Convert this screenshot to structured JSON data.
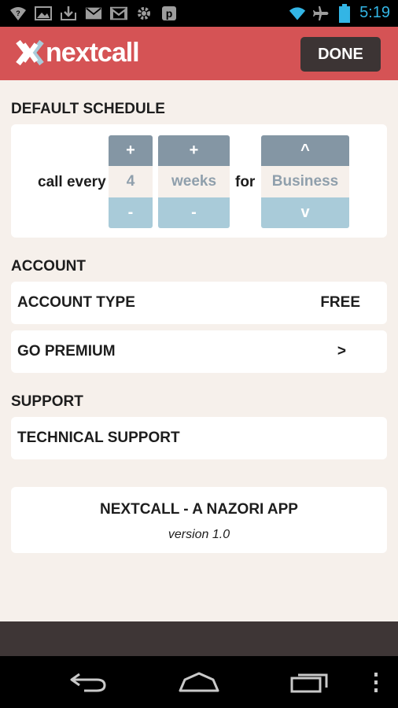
{
  "status_bar": {
    "time": "5:19",
    "notification_icons": [
      "wifi-question-icon",
      "image-icon",
      "download-icon",
      "gmail-icon",
      "gmail-icon",
      "gear-icon",
      "pandora-icon"
    ],
    "system_icons": [
      "wifi-icon",
      "airplane-icon",
      "battery-icon"
    ]
  },
  "header": {
    "logo_text": "nextcall",
    "done_label": "DONE",
    "brand_color": "#d55355"
  },
  "schedule": {
    "heading": "DEFAULT SCHEDULE",
    "call_every_label": "call every",
    "for_label": "for",
    "count": {
      "increment": "+",
      "value": "4",
      "decrement": "-"
    },
    "unit": {
      "increment": "+",
      "value": "weeks",
      "decrement": "-"
    },
    "category": {
      "increment": "^",
      "value": "Business",
      "decrement": "v"
    }
  },
  "account": {
    "heading": "ACCOUNT",
    "type_label": "ACCOUNT TYPE",
    "type_value": "FREE",
    "premium_label": "GO PREMIUM",
    "premium_arrow": ">"
  },
  "support": {
    "heading": "SUPPORT",
    "technical_label": "TECHNICAL SUPPORT"
  },
  "about": {
    "title": "NEXTCALL - A NAZORI APP",
    "version": "version 1.0"
  },
  "nav": {
    "buttons": [
      "back-icon",
      "home-icon",
      "recent-apps-icon",
      "menu-icon"
    ]
  }
}
